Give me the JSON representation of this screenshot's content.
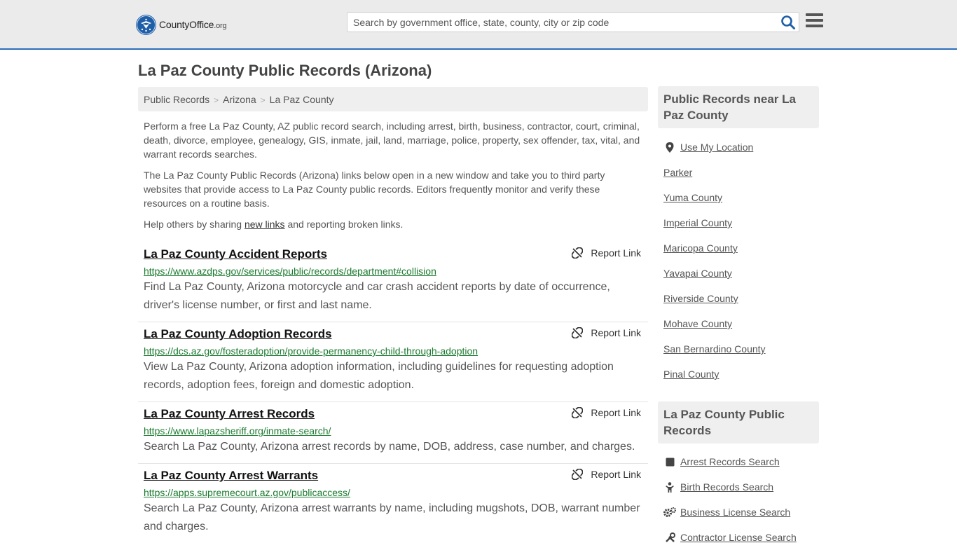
{
  "header": {
    "logo_name": "CountyOffice",
    "logo_tld": ".org",
    "search_placeholder": "Search by government office, state, county, city or zip code",
    "search_icon": "search-icon",
    "menu_icon": "hamburger-menu-icon"
  },
  "page_title": "La Paz County Public Records (Arizona)",
  "breadcrumb": [
    "Public Records",
    "Arizona",
    "La Paz County"
  ],
  "intro": {
    "p1": "Perform a free La Paz County, AZ public record search, including arrest, birth, business, contractor, court, criminal, death, divorce, employee, genealogy, GIS, inmate, jail, land, marriage, police, property, sex offender, tax, vital, and warrant records searches.",
    "p2": "The La Paz County Public Records (Arizona) links below open in a new window and take you to third party websites that provide access to La Paz County public records. Editors frequently monitor and verify these resources on a routine basis.",
    "p3_before": "Help others by sharing ",
    "p3_link": "new links",
    "p3_after": " and reporting broken links."
  },
  "report_label": "Report Link",
  "records": [
    {
      "title": "La Paz County Accident Reports",
      "url": "https://www.azdps.gov/services/public/records/department#collision",
      "desc": "Find La Paz County, Arizona motorcycle and car crash accident reports by date of occurrence, driver's license number, or first and last name."
    },
    {
      "title": "La Paz County Adoption Records",
      "url": "https://dcs.az.gov/fosteradoption/provide-permanency-child-through-adoption",
      "desc": "View La Paz County, Arizona adoption information, including guidelines for requesting adoption records, adoption fees, foreign and domestic adoption."
    },
    {
      "title": "La Paz County Arrest Records",
      "url": "https://www.lapazsheriff.org/inmate-search/",
      "desc": "Search La Paz County, Arizona arrest records by name, DOB, address, case number, and charges."
    },
    {
      "title": "La Paz County Arrest Warrants",
      "url": "https://apps.supremecourt.az.gov/publicaccess/",
      "desc": "Search La Paz County, Arizona arrest warrants by name, including mugshots, DOB, warrant number and charges."
    }
  ],
  "sidebar": {
    "nearby_title": "Public Records near La Paz County",
    "use_location": "Use My Location",
    "nearby": [
      "Parker",
      "Yuma County",
      "Imperial County",
      "Maricopa County",
      "Yavapai County",
      "Riverside County",
      "Mohave County",
      "San Bernardino County",
      "Pinal County"
    ],
    "county_title": "La Paz County Public Records",
    "county_links": [
      {
        "label": "Arrest Records Search",
        "icon": "square-icon"
      },
      {
        "label": "Birth Records Search",
        "icon": "baby-icon"
      },
      {
        "label": "Business License Search",
        "icon": "gears-icon"
      },
      {
        "label": "Contractor License Search",
        "icon": "tools-icon"
      }
    ]
  }
}
